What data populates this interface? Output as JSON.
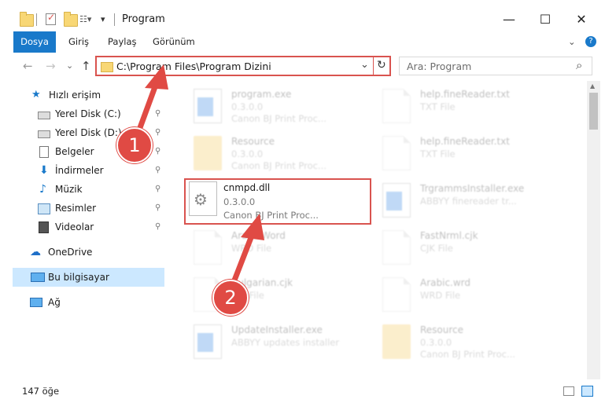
{
  "window": {
    "title": "Program",
    "minimize": "—",
    "maximize": "☐",
    "close": "✕"
  },
  "ribbon": {
    "tabs": [
      "Dosya",
      "Giriş",
      "Paylaş",
      "Görünüm"
    ],
    "expand": "⌄",
    "help": "?"
  },
  "address": {
    "back": "←",
    "forward": "→",
    "recent": "⌄",
    "up": "↑",
    "path": "C:\\Program Files\\Program Dizini",
    "dropdown": "⌄",
    "refresh": "↻"
  },
  "search": {
    "placeholder": "Ara: Program",
    "icon": "⌕"
  },
  "sidebar": {
    "quick_access": "Hızlı erişim",
    "items": [
      {
        "label": "Yerel Disk (C:)",
        "icon": "drive-icon",
        "pinned": true
      },
      {
        "label": "Yerel Disk (D:)",
        "icon": "drive-icon",
        "pinned": true
      },
      {
        "label": "Belgeler",
        "icon": "documents-icon",
        "pinned": true
      },
      {
        "label": "İndirmeler",
        "icon": "download-icon",
        "pinned": true
      },
      {
        "label": "Müzik",
        "icon": "music-icon",
        "pinned": true
      },
      {
        "label": "Resimler",
        "icon": "pictures-icon",
        "pinned": true
      },
      {
        "label": "Videolar",
        "icon": "videos-icon",
        "pinned": true
      }
    ],
    "onedrive": "OneDrive",
    "this_pc": "Bu bilgisayar",
    "network": "Ağ",
    "pin_glyph": "📌"
  },
  "files": [
    {
      "name": "program.exe",
      "line2": "0.3.0.0",
      "line3": "Canon BJ Print Proc...",
      "icon": "exe-icon"
    },
    {
      "name": "help.fineReader.txt",
      "line2": "TXT File",
      "line3": "",
      "icon": "text-file-icon"
    },
    {
      "name": "Resource",
      "line2": "0.3.0.0",
      "line3": "Canon BJ Print Proc...",
      "icon": "folder-icon"
    },
    {
      "name": "help.fineReader.txt",
      "line2": "TXT File",
      "line3": "",
      "icon": "text-file-icon"
    },
    {
      "name": "cnmpd.dll",
      "line2": "0.3.0.0",
      "line3": "Canon BJ Print Proc...",
      "icon": "dll-icon"
    },
    {
      "name": "TrgrammsInstaller.exe",
      "line2": "ABBYY finereader tr...",
      "line3": "",
      "icon": "installer-icon"
    },
    {
      "name": "ArabicWord",
      "line2": "WRD File",
      "line3": "",
      "icon": "file-icon"
    },
    {
      "name": "FastNrml.cjk",
      "line2": "CJK File",
      "line3": "",
      "icon": "file-icon"
    },
    {
      "name": "Bulgarian.cjk",
      "line2": "CJK File",
      "line3": "",
      "icon": "file-icon"
    },
    {
      "name": "Arabic.wrd",
      "line2": "WRD File",
      "line3": "",
      "icon": "file-icon"
    },
    {
      "name": "UpdateInstaller.exe",
      "line2": "ABBYY updates installer",
      "line3": "",
      "icon": "installer-icon"
    },
    {
      "name": "Resource",
      "line2": "0.3.0.0",
      "line3": "Canon BJ Print Proc...",
      "icon": "folder-icon"
    }
  ],
  "status": {
    "count": "147 öğe"
  },
  "annotations": {
    "step1": "1",
    "step2": "2",
    "color": "#e04a44"
  }
}
